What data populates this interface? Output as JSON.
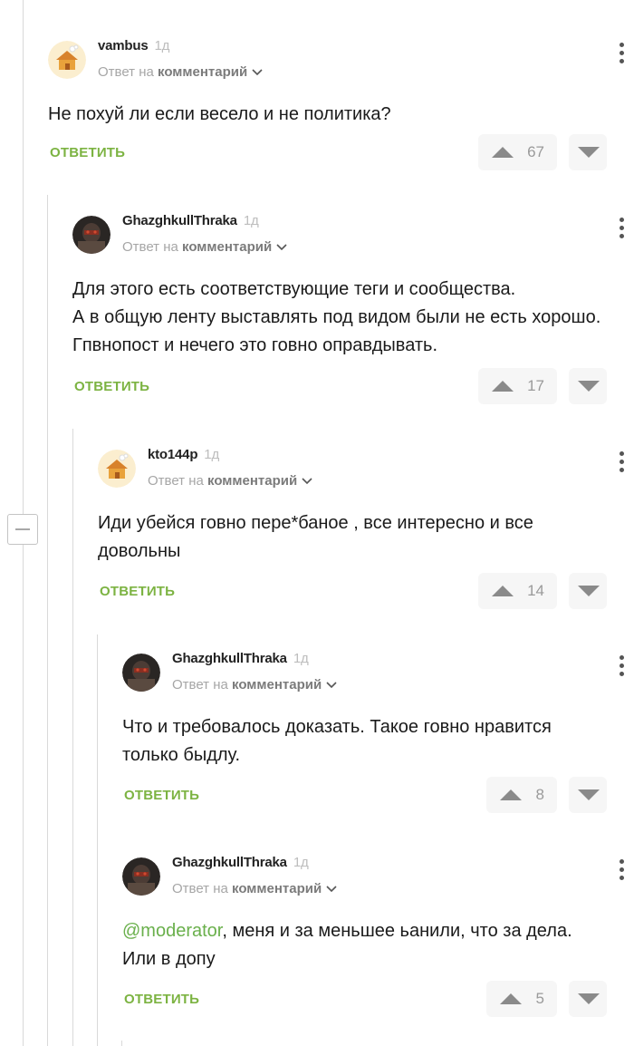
{
  "comments": [
    {
      "author": "vambus",
      "time": "1д",
      "reply_prefix": "Ответ на",
      "reply_target": "комментарий",
      "text": "Не похуй ли если весело и не политика?",
      "reply_label": "ОТВЕТИТЬ",
      "votes": "67",
      "avatar": "cartoon-house-avatar"
    },
    {
      "author": "GhazghkullThraka",
      "time": "1д",
      "reply_prefix": "Ответ на",
      "reply_target": "комментарий",
      "text": "Для этого есть соответствующие теги и сообщества.\nА в общую ленту выставлять под видом были не есть хорошо. Гпвнопост и нечего это говно оправдывать.",
      "reply_label": "ОТВЕТИТЬ",
      "votes": "17",
      "avatar": "armored-warrior-avatar"
    },
    {
      "author": "kto144p",
      "time": "1д",
      "reply_prefix": "Ответ на",
      "reply_target": "комментарий",
      "text": "Иди убейся говно пере*баное , все интересно и все довольны",
      "reply_label": "ОТВЕТИТЬ",
      "votes": "14",
      "avatar": "cartoon-house-avatar"
    },
    {
      "author": "GhazghkullThraka",
      "time": "1д",
      "reply_prefix": "Ответ на",
      "reply_target": "комментарий",
      "text": "Что и требовалось доказать. Такое говно нравится только быдлу.",
      "reply_label": "ОТВЕТИТЬ",
      "votes": "8",
      "avatar": "armored-warrior-avatar"
    },
    {
      "author": "GhazghkullThraka",
      "time": "1д",
      "reply_prefix": "Ответ на",
      "reply_target": "комментарий",
      "mention": "@moderator",
      "text": ", меня и за меньшее ьанили, что за дела. Или в допу",
      "reply_label": "ОТВЕТИТЬ",
      "votes": "5",
      "avatar": "armored-warrior-avatar"
    }
  ],
  "colors": {
    "accent_green": "#7cb342",
    "mention_green": "#6ab04c",
    "thread_line": "#d9d9d9"
  }
}
